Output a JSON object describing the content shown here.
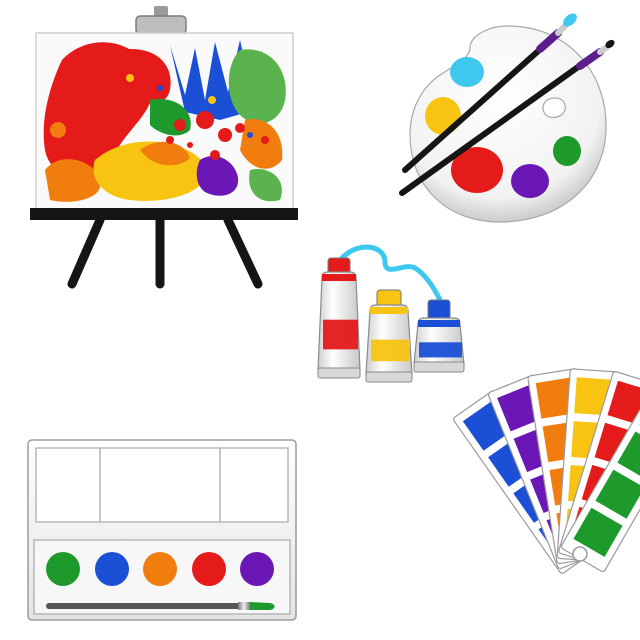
{
  "illustrations": [
    {
      "name": "easel-with-painting",
      "icon": "easel-icon"
    },
    {
      "name": "artist-palette-with-brushes",
      "icon": "palette-icon"
    },
    {
      "name": "paint-tubes",
      "icon": "paint-tube-icon"
    },
    {
      "name": "watercolor-paint-box",
      "icon": "paint-box-icon"
    },
    {
      "name": "color-swatch-fan",
      "icon": "swatch-fan-icon"
    }
  ],
  "colors": {
    "red": "#e51a1a",
    "orange": "#f07d0e",
    "yellow": "#f8c411",
    "green": "#1e9a2c",
    "blue": "#1a4fd6",
    "cyan": "#3fc8ee",
    "purple": "#6a17b5",
    "black": "#111111"
  },
  "palette_wells": [
    "cyan",
    "yellow",
    "red",
    "purple",
    "green"
  ],
  "paint_box_wells": [
    "green",
    "blue",
    "orange",
    "red",
    "purple"
  ],
  "paint_tubes": [
    "red",
    "yellow",
    "blue"
  ],
  "swatch_fan_strips": [
    [
      "blue",
      "blue",
      "blue",
      "blue"
    ],
    [
      "purple",
      "purple",
      "purple",
      "purple"
    ],
    [
      "orange",
      "orange",
      "orange",
      "orange"
    ],
    [
      "yellow",
      "yellow",
      "yellow",
      "yellow"
    ],
    [
      "red",
      "red",
      "red",
      "red"
    ],
    [
      "green",
      "green",
      "green",
      "green"
    ]
  ]
}
